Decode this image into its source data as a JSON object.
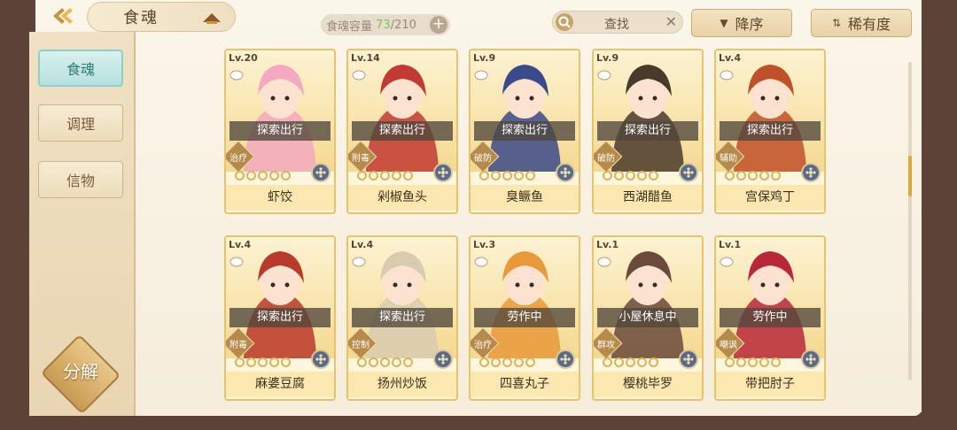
{
  "header": {
    "title": "食魂",
    "capacity_label": "食魂容量",
    "capacity_current": "73",
    "capacity_max": "/210",
    "capacity_plus": "+",
    "search_placeholder": "查找",
    "search_clear": "✕",
    "sort_order_label": "降序",
    "sort_field_label": "稀有度"
  },
  "sidebar": {
    "items": [
      {
        "label": "食魂"
      },
      {
        "label": "调理"
      },
      {
        "label": "信物"
      }
    ],
    "decompose_label": "分解"
  },
  "cards": [
    {
      "level": "Lv.20",
      "status": "探索出行",
      "role": "治疗",
      "stars": 0,
      "name": "虾饺",
      "palette": "#f4a9c0"
    },
    {
      "level": "Lv.14",
      "status": "探索出行",
      "role": "附毒",
      "stars": 0,
      "name": "剁椒鱼头",
      "palette": "#c23a33"
    },
    {
      "level": "Lv.9",
      "status": "探索出行",
      "role": "破防",
      "stars": 0,
      "name": "臭鳜鱼",
      "palette": "#3b4a8a"
    },
    {
      "level": "Lv.9",
      "status": "探索出行",
      "role": "破防",
      "stars": 0,
      "name": "西湖醋鱼",
      "palette": "#4a3a2c"
    },
    {
      "level": "Lv.4",
      "status": "探索出行",
      "role": "辅助",
      "stars": 0,
      "name": "宫保鸡丁",
      "palette": "#c0502a"
    },
    {
      "level": "Lv.4",
      "status": "探索出行",
      "role": "附毒",
      "stars": 0,
      "name": "麻婆豆腐",
      "palette": "#b83a2a"
    },
    {
      "level": "Lv.4",
      "status": "探索出行",
      "role": "控制",
      "stars": 0,
      "name": "扬州炒饭",
      "palette": "#d8ccb0"
    },
    {
      "level": "Lv.3",
      "status": "劳作中",
      "role": "治疗",
      "stars": 0,
      "name": "四喜丸子",
      "palette": "#e89a3a"
    },
    {
      "level": "Lv.1",
      "status": "小屋休息中",
      "role": "群攻",
      "stars": 0,
      "name": "樱桃毕罗",
      "palette": "#6a4a3a"
    },
    {
      "level": "Lv.1",
      "status": "劳作中",
      "role": "嘲讽",
      "stars": 0,
      "name": "带把肘子",
      "palette": "#b8283a"
    }
  ],
  "colors": {
    "accent_gold": "#e8c36a",
    "active_tab": "#8fd0cb",
    "capacity_current": "#7fbf6a"
  },
  "icons": {
    "back": "chevron-left-icon",
    "search": "magnifier-icon",
    "sort_desc": "triangle-down-icon",
    "sort_rarity": "sort-arrows-icon",
    "emblem": "flower-emblem-icon"
  }
}
